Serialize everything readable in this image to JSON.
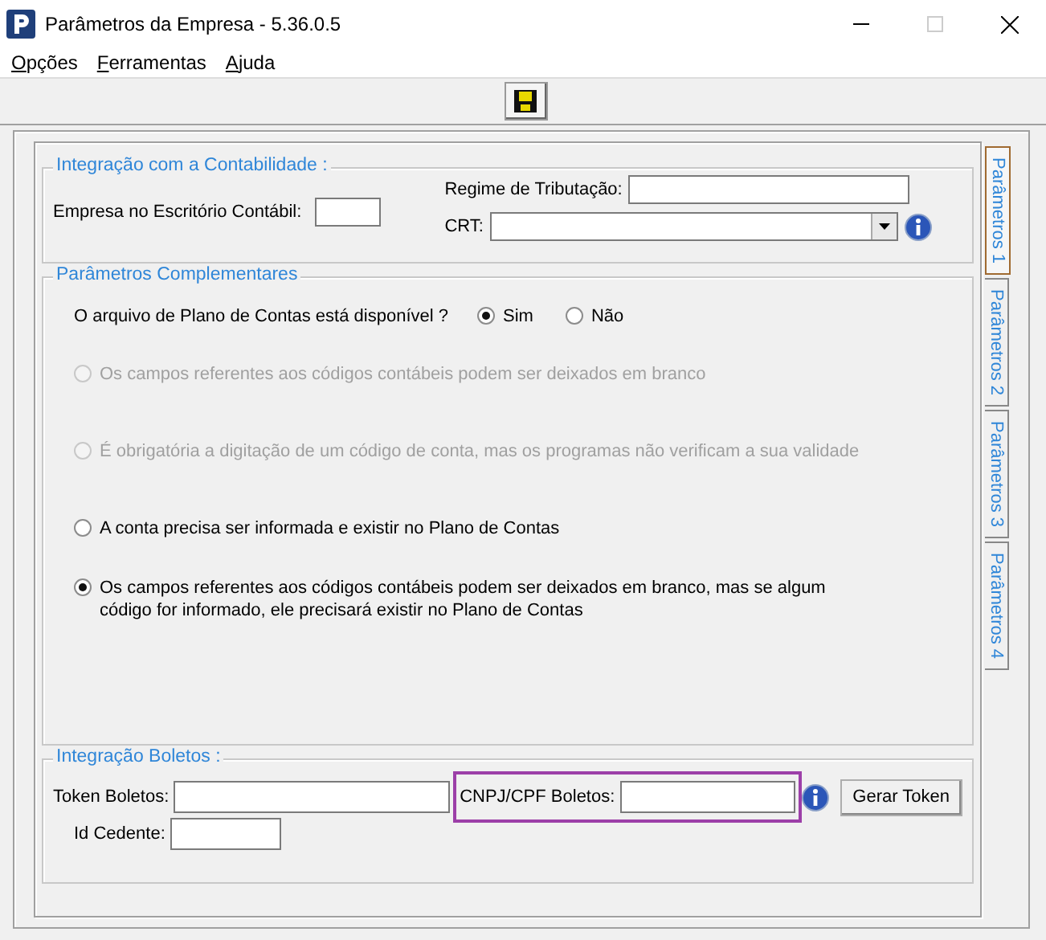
{
  "window": {
    "title": "Parâmetros da Empresa - 5.36.0.5"
  },
  "menu": [
    {
      "label": "Opções"
    },
    {
      "label": "Ferramentas"
    },
    {
      "label": "Ajuda"
    }
  ],
  "accounting": {
    "title": "Integração com a Contabilidade :",
    "office_company": {
      "label": "Empresa no Escritório Contábil:"
    },
    "tax_regime": {
      "label": "Regime de Tributação:"
    },
    "crt": {
      "label": "CRT:"
    }
  },
  "complementary": {
    "title": "Parâmetros Complementares",
    "question": "O arquivo de Plano de Contas está disponível ?",
    "availability": [
      {
        "label": "Sim",
        "selected": true
      },
      {
        "label": "Não",
        "selected": false
      }
    ],
    "rules": [
      {
        "label": "Os campos referentes aos códigos contábeis podem ser deixados em branco",
        "selected": false,
        "disabled": true
      },
      {
        "label": "É obrigatória a digitação de um código de conta, mas os programas não verificam a sua validade",
        "selected": false,
        "disabled": true
      },
      {
        "label": "A conta precisa ser informada e existir no Plano de Contas",
        "selected": false,
        "disabled": false
      },
      {
        "label": "Os campos referentes aos códigos contábeis podem ser deixados em branco, mas se algum código for informado, ele precisará existir no Plano de Contas",
        "selected": true,
        "disabled": false
      }
    ]
  },
  "boletos": {
    "title": "Integração Boletos :",
    "token": {
      "label": "Token Boletos:"
    },
    "cnpj": {
      "label": "CNPJ/CPF Boletos:",
      "highlighted": true
    },
    "generate_button": "Gerar Token",
    "cedente": {
      "label": "Id Cedente:"
    }
  },
  "tabs": [
    {
      "label": "Parâmetros 1",
      "selected": true
    },
    {
      "label": "Parâmetros 2",
      "selected": false
    },
    {
      "label": "Parâmetros 3",
      "selected": false
    },
    {
      "label": "Parâmetros 4",
      "selected": false
    }
  ]
}
